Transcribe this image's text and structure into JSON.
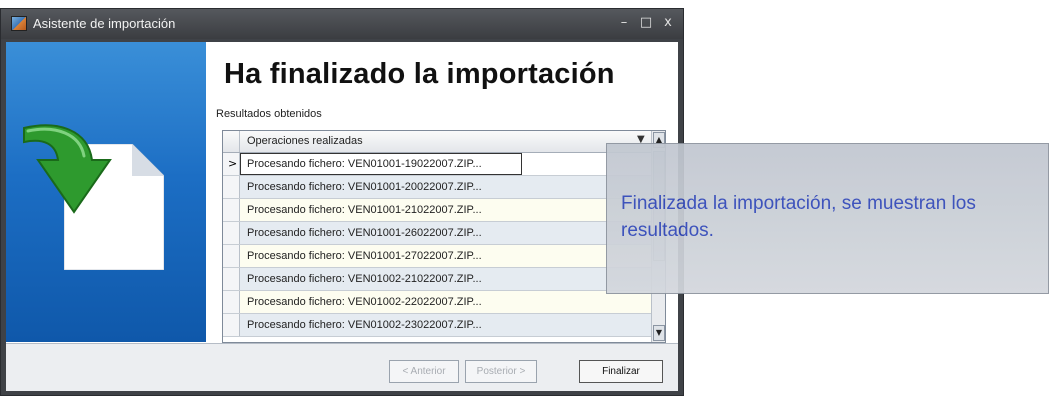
{
  "window": {
    "title": "Asistente de importación",
    "controls": {
      "minimize": "–",
      "maximize": "□",
      "close": "x"
    }
  },
  "banner": {
    "icon": "import-document-arrow-icon"
  },
  "header": {
    "heading": "Ha finalizado la importación",
    "subtitle": "Resultados obtenidos"
  },
  "grid": {
    "column_header": "Operaciones realizadas",
    "selected_marker": ">",
    "rows": [
      "Procesando fichero: VEN01001-19022007.ZIP...",
      "Procesando fichero: VEN01001-20022007.ZIP...",
      "Procesando fichero: VEN01001-21022007.ZIP...",
      "Procesando fichero: VEN01001-26022007.ZIP...",
      "Procesando fichero: VEN01001-27022007.ZIP...",
      "Procesando fichero: VEN01002-21022007.ZIP...",
      "Procesando fichero: VEN01002-22022007.ZIP...",
      "Procesando fichero: VEN01002-23022007.ZIP..."
    ]
  },
  "footer": {
    "prev_label": "< Anterior",
    "next_label": "Posterior >",
    "finish_label": "Finalizar"
  },
  "tooltip": {
    "text": "Finalizada la importación, se muestran los resultados."
  },
  "colors": {
    "banner": "#1c6ec4",
    "tooltip_text": "#3047b8",
    "arrow": "#2e9a2e"
  }
}
